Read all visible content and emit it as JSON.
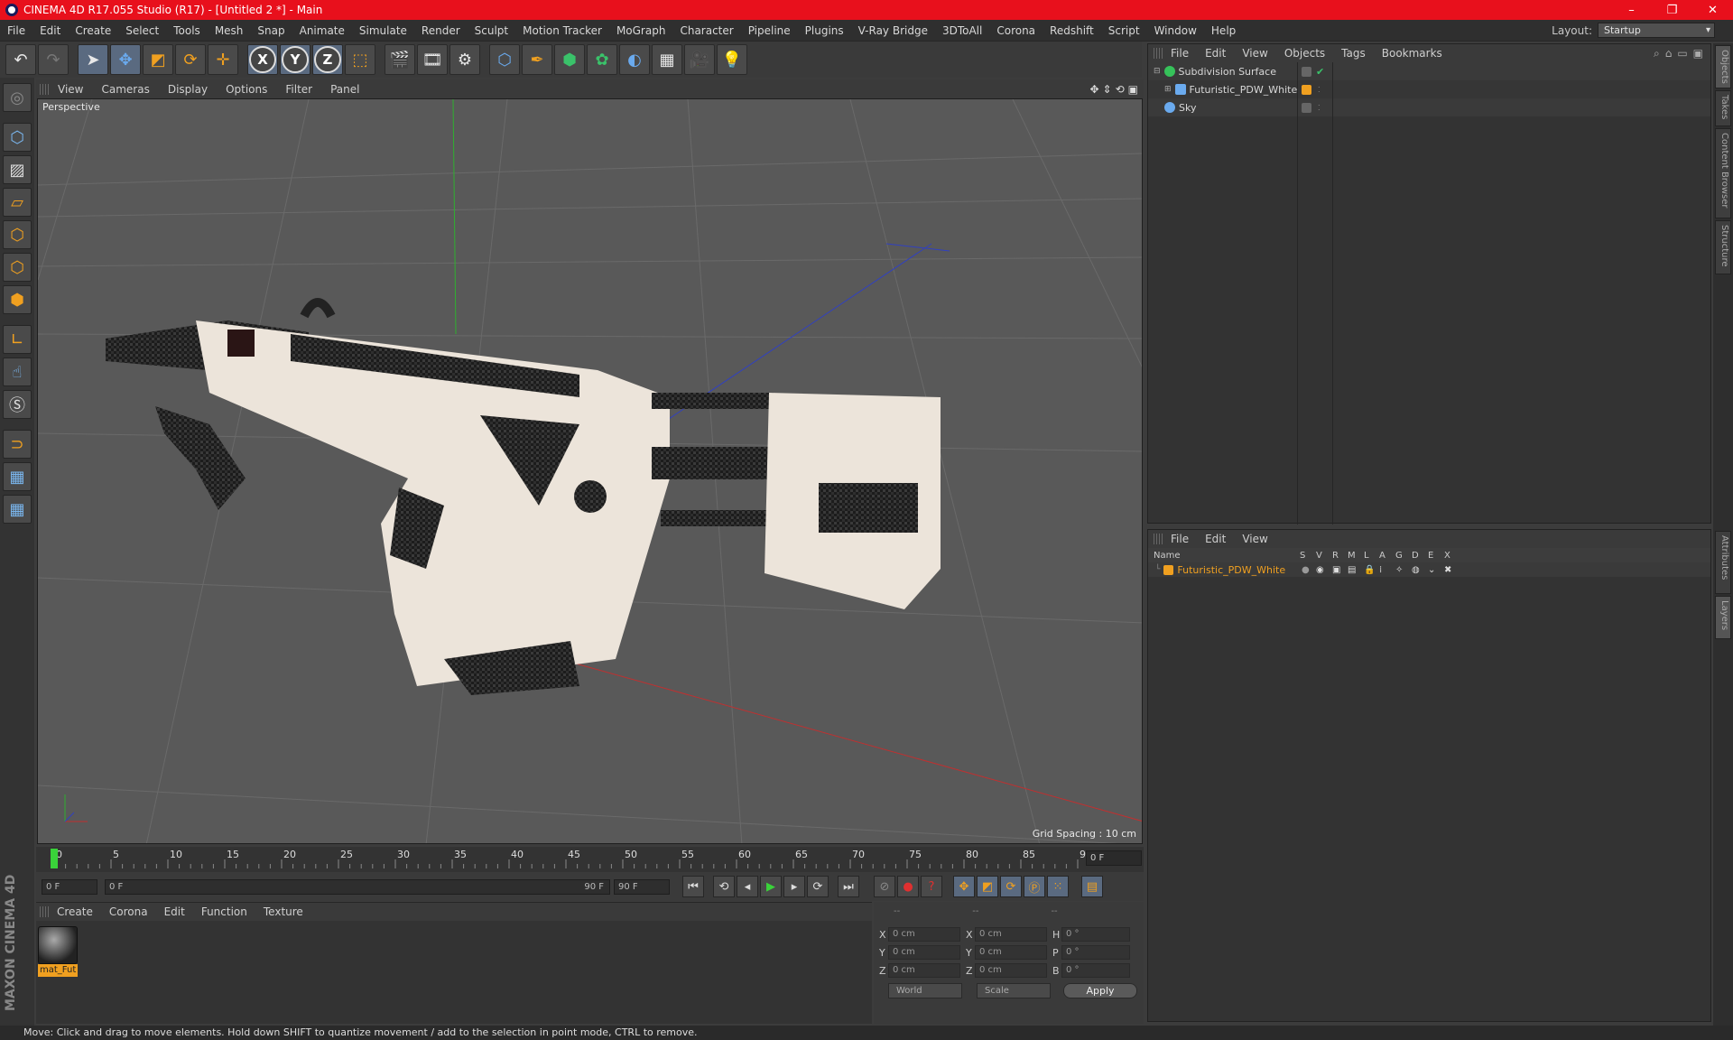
{
  "app": {
    "title": "CINEMA 4D R17.055 Studio (R17) - [Untitled 2 *] - Main",
    "minimize": "–",
    "restore": "❐",
    "close": "✕"
  },
  "menu": {
    "items": [
      "File",
      "Edit",
      "Create",
      "Select",
      "Tools",
      "Mesh",
      "Snap",
      "Animate",
      "Simulate",
      "Render",
      "Sculpt",
      "Motion Tracker",
      "MoGraph",
      "Character",
      "Pipeline",
      "Plugins",
      "V-Ray Bridge",
      "3DToAll",
      "Corona",
      "Redshift",
      "Script",
      "Window",
      "Help"
    ],
    "layout_label": "Layout:",
    "layout_value": "Startup"
  },
  "toolbar": {
    "axis_x": "X",
    "axis_y": "Y",
    "axis_z": "Z"
  },
  "viewport": {
    "menu": [
      "View",
      "Cameras",
      "Display",
      "Options",
      "Filter",
      "Panel"
    ],
    "label": "Perspective",
    "grid_spacing": "Grid Spacing : 10 cm"
  },
  "timeline": {
    "ticks": [
      "0",
      "5",
      "10",
      "15",
      "20",
      "25",
      "30",
      "35",
      "40",
      "45",
      "50",
      "55",
      "60",
      "65",
      "70",
      "75",
      "80",
      "85",
      "90"
    ],
    "current_frame": "0 F"
  },
  "transport": {
    "start": "0 F",
    "range_start": "0 F",
    "range_end": "90 F",
    "end": "90 F"
  },
  "material_panel": {
    "menu": [
      "Create",
      "Corona",
      "Edit",
      "Function",
      "Texture"
    ],
    "material_name": "mat_Fut"
  },
  "coords": {
    "headers": [
      "--",
      "--",
      "--"
    ],
    "rows": [
      {
        "a": "X",
        "av": "0 cm",
        "b": "X",
        "bv": "0 cm",
        "c": "H",
        "cv": "0 °"
      },
      {
        "a": "Y",
        "av": "0 cm",
        "b": "Y",
        "bv": "0 cm",
        "c": "P",
        "cv": "0 °"
      },
      {
        "a": "Z",
        "av": "0 cm",
        "b": "Z",
        "bv": "0 cm",
        "c": "B",
        "cv": "0 °"
      }
    ],
    "mode": "World",
    "size_mode": "Scale",
    "apply": "Apply"
  },
  "object_manager": {
    "menu": [
      "File",
      "Edit",
      "View",
      "Objects",
      "Tags",
      "Bookmarks"
    ],
    "objects": [
      {
        "name": "Subdivision Surface",
        "color": "#36c25a"
      },
      {
        "name": "Futuristic_PDW_White",
        "color": "#6aaaee"
      },
      {
        "name": "Sky",
        "color": "#6aaaee"
      }
    ]
  },
  "layer_manager": {
    "menu": [
      "File",
      "Edit",
      "View"
    ],
    "columns": [
      "Name",
      "S",
      "V",
      "R",
      "M",
      "L",
      "A",
      "G",
      "D",
      "E",
      "X"
    ],
    "layer_name": "Futuristic_PDW_White",
    "layer_color": "#f0a020"
  },
  "right_tabs": [
    "Objects",
    "Takes",
    "Content Browser",
    "Structure",
    "Attributes",
    "Layers"
  ],
  "brand": "MAXON CINEMA 4D",
  "status": "Move: Click and drag to move elements. Hold down SHIFT to quantize movement / add to the selection in point mode, CTRL to remove."
}
